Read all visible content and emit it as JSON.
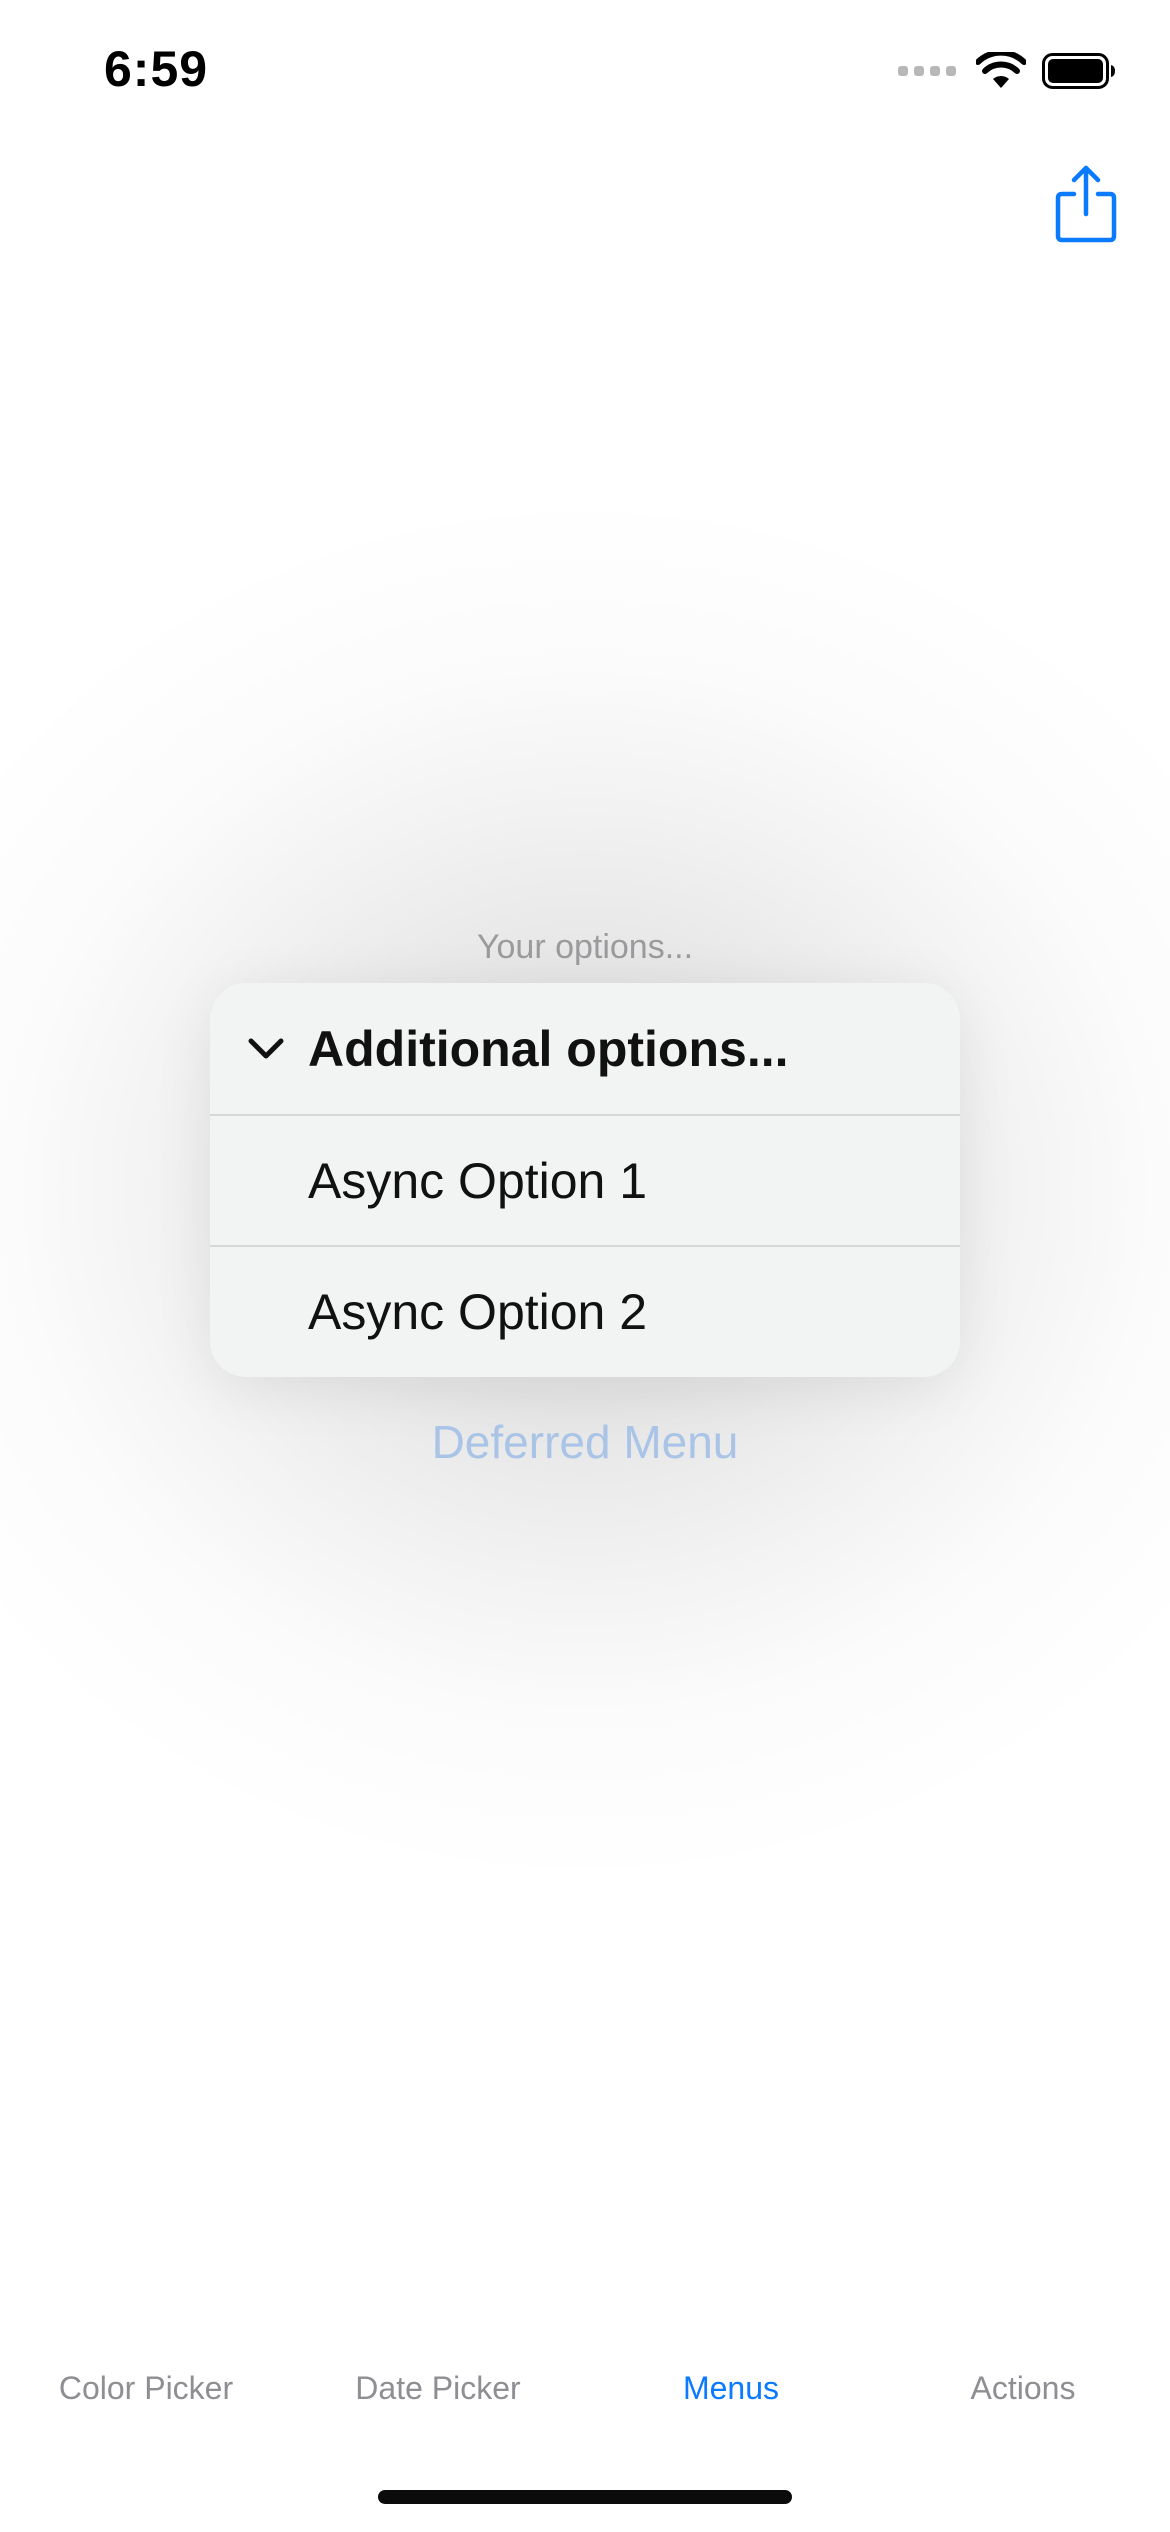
{
  "status_bar": {
    "time": "6:59",
    "icons": [
      "cellular-signal-icon",
      "wifi-icon",
      "battery-icon"
    ]
  },
  "nav": {
    "share_icon": "share-icon",
    "accent_color": "#0A7AFF"
  },
  "menu": {
    "caption": "Your options...",
    "header": {
      "icon": "chevron-down-icon",
      "label": "Additional options..."
    },
    "items": [
      {
        "label": "Async Option 1"
      },
      {
        "label": "Async Option 2"
      }
    ],
    "trigger_label": "Deferred Menu"
  },
  "tabbar": {
    "tabs": [
      {
        "label": "Color Picker",
        "active": false
      },
      {
        "label": "Date Picker",
        "active": false
      },
      {
        "label": "Menus",
        "active": true
      },
      {
        "label": "Actions",
        "active": false
      }
    ]
  }
}
